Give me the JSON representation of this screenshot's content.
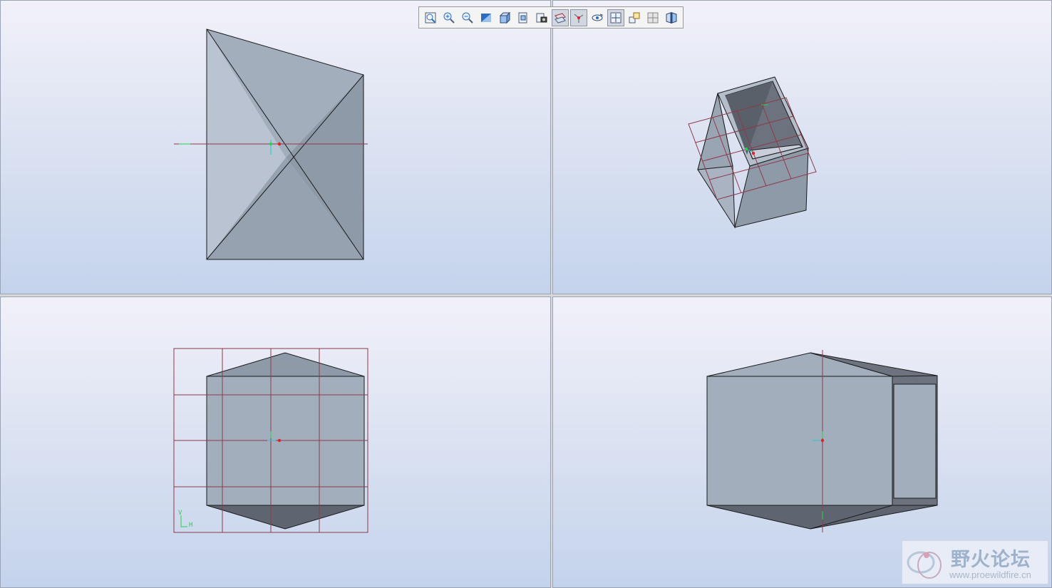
{
  "toolbar": {
    "buttons": [
      {
        "name": "refit-icon"
      },
      {
        "name": "zoom-in-icon"
      },
      {
        "name": "zoom-out-icon"
      },
      {
        "name": "repaint-icon"
      },
      {
        "name": "display-style-icon"
      },
      {
        "name": "saved-views-icon"
      },
      {
        "name": "view-manager-icon"
      },
      {
        "name": "datum-planes-icon",
        "active": true
      },
      {
        "name": "datum-axes-icon",
        "active": true
      },
      {
        "name": "spin-center-icon"
      },
      {
        "name": "coordinate-systems-icon",
        "active": true
      },
      {
        "name": "annotation-display-icon"
      },
      {
        "name": "multi-view-icon"
      },
      {
        "name": "sketch-view-icon"
      }
    ]
  },
  "viewports": {
    "bottom_left": {
      "axis_y": "V",
      "axis_x": "H"
    }
  },
  "watermark": {
    "title": "野火论坛",
    "url": "www.proewildfire.cn"
  },
  "colors": {
    "face_light": "#b9c3d1",
    "face_mid": "#a3aebd",
    "face_dark": "#8f9aa9",
    "face_darkest": "#5f6570",
    "datum_plane": "#8c3a4a",
    "datum_axis_green": "#2ad24a",
    "origin_red": "#e0202a",
    "axis_cyan": "#22c8d0"
  }
}
